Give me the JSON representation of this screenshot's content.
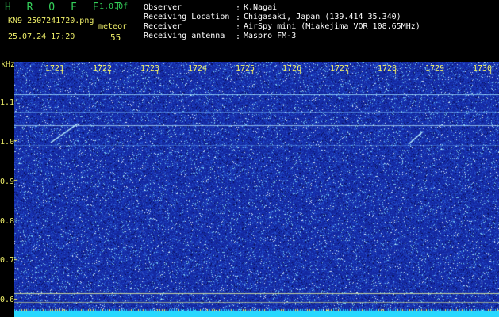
{
  "header": {
    "logo": "H R O F F T",
    "version": "1.0.0f",
    "filename": "KN9_2507241720.png",
    "datetime": "25.07.24 17:20",
    "meteor_label": "meteor",
    "meteor_count": "55"
  },
  "info": {
    "rows": [
      {
        "key": "Observer",
        "value": "K.Nagai"
      },
      {
        "key": "Receiving Location",
        "value": "Chigasaki, Japan (139.414 35.340)"
      },
      {
        "key": "Receiver",
        "value": "AirSpy mini (Miakejima VOR 108.65MHz)"
      },
      {
        "key": "Receiving antenna",
        "value": "Maspro FM-3"
      }
    ]
  },
  "axis": {
    "unit": "kHz",
    "yticks": [
      "1.1",
      "1.0",
      "0.9",
      "0.8",
      "0.7",
      "0.6"
    ],
    "minutes": [
      "1721",
      "1722",
      "1723",
      "1724",
      "1725",
      "1726",
      "1727",
      "1728",
      "1729",
      "1730"
    ]
  },
  "colors": {
    "noise_bg": "#1a2fa8",
    "axis_text": "#f2f26a",
    "title_green": "#34d05a",
    "bottom_strip": "#27d8ff"
  }
}
